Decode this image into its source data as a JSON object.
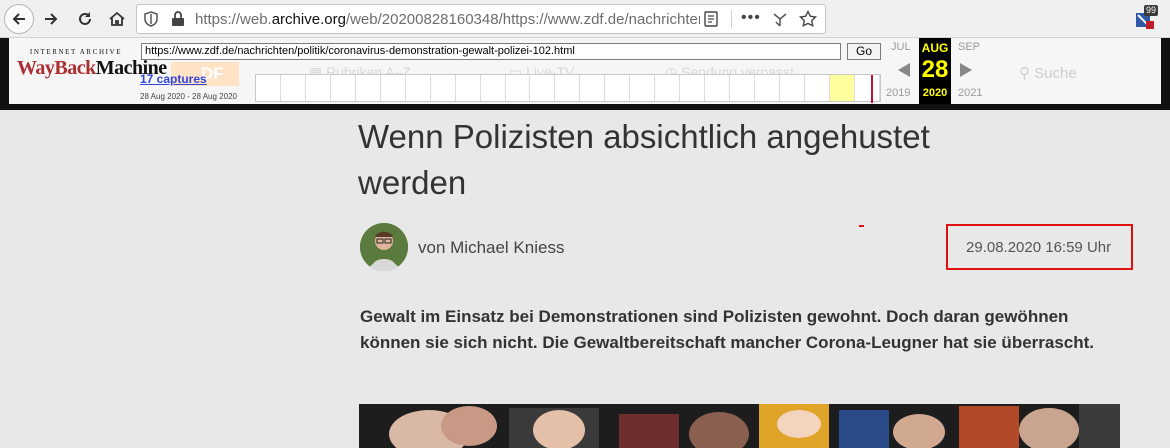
{
  "browser": {
    "url_prefix": "https://web.",
    "url_domain": "archive.org",
    "url_rest": "/web/20200828160348/https://www.zdf.de/nachrichten",
    "extension_badge": "99"
  },
  "wayback": {
    "logo_top": "INTERNET ARCHIVE",
    "logo_way": "WayBack",
    "logo_machine": "Machine",
    "url_value": "https://www.zdf.de/nachrichten/politik/coronavirus-demonstration-gewalt-polizei-102.html",
    "go_label": "Go",
    "captures": "17 captures",
    "date_range": "28 Aug 2020 - 28 Aug 2020",
    "prev_month": "JUL",
    "current_month": "AUG",
    "next_month": "SEP",
    "current_day": "28",
    "prev_year": "2019",
    "current_year": "2020",
    "next_year": "2021"
  },
  "ghost_nav": {
    "logo": "DF",
    "item1": "Rubriken A–Z",
    "item2": "Live-TV",
    "item3": "Sendung verpasst",
    "search": "Suche"
  },
  "article": {
    "headline": "Wenn Polizisten absichtlich angehustet werden",
    "author": "von Michael Kniess",
    "date": "29.08.2020 16:59 Uhr",
    "lead": "Gewalt im Einsatz bei Demonstrationen sind Polizisten gewohnt. Doch daran gewöhnen können sie sich nicht. Die Gewaltbereitschaft mancher Corona-Leugner hat sie überrascht."
  },
  "colors": {
    "highlight_box": "#e01010",
    "wayback_accent": "#ffff00",
    "wayback_red": "#ab2e33"
  }
}
